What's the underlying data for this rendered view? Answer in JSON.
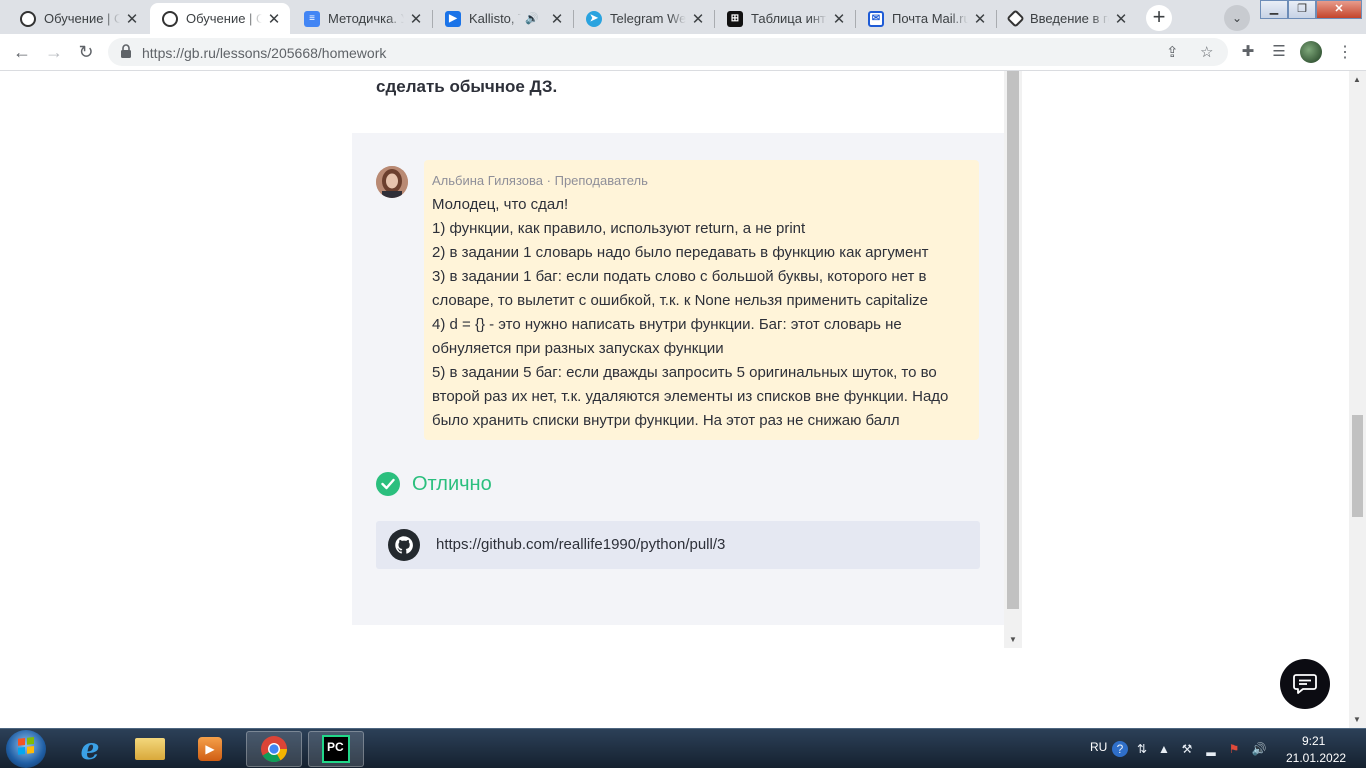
{
  "browser": {
    "tabs": [
      {
        "title": "Обучение | GeekBrains",
        "favicon": "geekbrains-icon",
        "active": false
      },
      {
        "title": "Обучение | GeekBrains",
        "favicon": "geekbrains-icon",
        "active": true
      },
      {
        "title": "Методичка. Урок",
        "favicon": "google-docs-icon",
        "active": false
      },
      {
        "title": "Kallisto, The",
        "favicon": "video-play-icon",
        "active": false,
        "audio": true
      },
      {
        "title": "Telegram Web",
        "favicon": "telegram-icon",
        "active": false
      },
      {
        "title": "Таблица интеграции",
        "favicon": "table-icon",
        "active": false
      },
      {
        "title": "Почта Mail.ru",
        "favicon": "mail-icon",
        "active": false
      },
      {
        "title": "Введение в ген",
        "favicon": "generic-site-icon",
        "active": false
      }
    ],
    "address_bar": {
      "url": "https://gb.ru/lessons/205668/homework"
    }
  },
  "page": {
    "homework_text": "сделать обычное ДЗ.",
    "review": {
      "author_name": "Альбина Гилязова",
      "separator": "·",
      "author_role": "Преподаватель",
      "lines": [
        "Молодец, что сдал!",
        "1) функции, как правило, используют return, а не print",
        "2) в задании 1 словарь надо было передавать в функцию как аргумент",
        "3) в задании 1 баг: если подать слово с большой буквы, которого нет в словаре, то вылетит с ошибкой, т.к. к None нельзя применить capitalize",
        "4) d = {} - это нужно написать внутри функции. Баг: этот словарь не обнуляется при разных запусках функции",
        "5) в задании 5 баг: если дважды запросить 5 оригинальных шуток, то во второй раз их нет, т.к. удаляются элементы из списков вне функции. Надо было хранить списки внутри функции. На этот раз не снижаю балл"
      ]
    },
    "grade": {
      "label": "Отлично",
      "color": "#2bbf7e"
    },
    "submission_link": "https://github.com/reallife1990/python/pull/3"
  },
  "taskbar": {
    "language": "RU",
    "time": "9:21",
    "date": "21.01.2022",
    "apps": [
      "internet-explorer-icon",
      "file-explorer-icon",
      "media-player-icon",
      "chrome-icon",
      "pycharm-icon"
    ]
  },
  "colors": {
    "bubble_bg": "#fff4d9",
    "panel_bg": "#f3f4f8",
    "grade_green": "#2bbf7e",
    "link_box_bg": "#e5e8f2"
  }
}
